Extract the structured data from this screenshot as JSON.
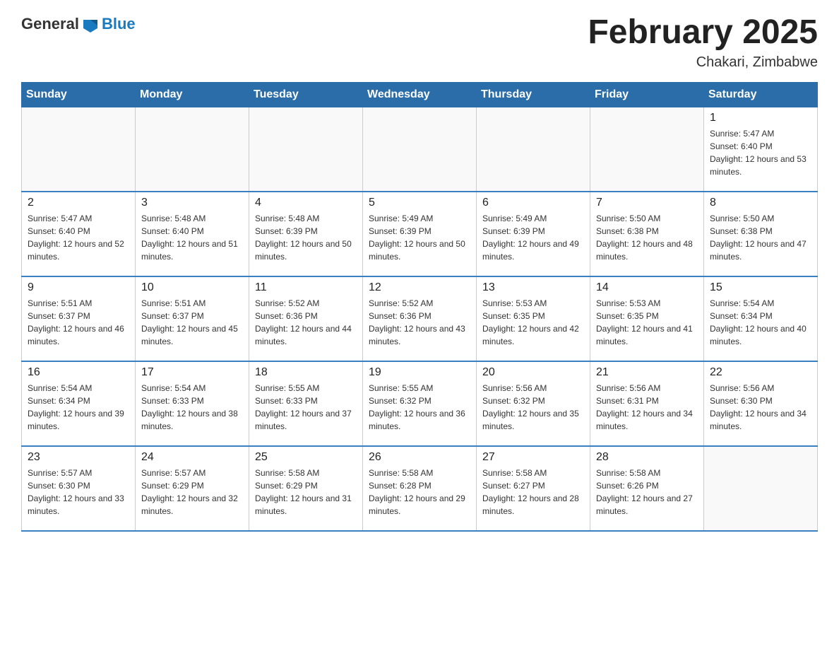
{
  "header": {
    "logo": {
      "general": "General",
      "blue": "Blue"
    },
    "title": "February 2025",
    "location": "Chakari, Zimbabwe"
  },
  "weekdays": [
    "Sunday",
    "Monday",
    "Tuesday",
    "Wednesday",
    "Thursday",
    "Friday",
    "Saturday"
  ],
  "weeks": [
    [
      {
        "day": "",
        "sunrise": "",
        "sunset": "",
        "daylight": ""
      },
      {
        "day": "",
        "sunrise": "",
        "sunset": "",
        "daylight": ""
      },
      {
        "day": "",
        "sunrise": "",
        "sunset": "",
        "daylight": ""
      },
      {
        "day": "",
        "sunrise": "",
        "sunset": "",
        "daylight": ""
      },
      {
        "day": "",
        "sunrise": "",
        "sunset": "",
        "daylight": ""
      },
      {
        "day": "",
        "sunrise": "",
        "sunset": "",
        "daylight": ""
      },
      {
        "day": "1",
        "sunrise": "Sunrise: 5:47 AM",
        "sunset": "Sunset: 6:40 PM",
        "daylight": "Daylight: 12 hours and 53 minutes."
      }
    ],
    [
      {
        "day": "2",
        "sunrise": "Sunrise: 5:47 AM",
        "sunset": "Sunset: 6:40 PM",
        "daylight": "Daylight: 12 hours and 52 minutes."
      },
      {
        "day": "3",
        "sunrise": "Sunrise: 5:48 AM",
        "sunset": "Sunset: 6:40 PM",
        "daylight": "Daylight: 12 hours and 51 minutes."
      },
      {
        "day": "4",
        "sunrise": "Sunrise: 5:48 AM",
        "sunset": "Sunset: 6:39 PM",
        "daylight": "Daylight: 12 hours and 50 minutes."
      },
      {
        "day": "5",
        "sunrise": "Sunrise: 5:49 AM",
        "sunset": "Sunset: 6:39 PM",
        "daylight": "Daylight: 12 hours and 50 minutes."
      },
      {
        "day": "6",
        "sunrise": "Sunrise: 5:49 AM",
        "sunset": "Sunset: 6:39 PM",
        "daylight": "Daylight: 12 hours and 49 minutes."
      },
      {
        "day": "7",
        "sunrise": "Sunrise: 5:50 AM",
        "sunset": "Sunset: 6:38 PM",
        "daylight": "Daylight: 12 hours and 48 minutes."
      },
      {
        "day": "8",
        "sunrise": "Sunrise: 5:50 AM",
        "sunset": "Sunset: 6:38 PM",
        "daylight": "Daylight: 12 hours and 47 minutes."
      }
    ],
    [
      {
        "day": "9",
        "sunrise": "Sunrise: 5:51 AM",
        "sunset": "Sunset: 6:37 PM",
        "daylight": "Daylight: 12 hours and 46 minutes."
      },
      {
        "day": "10",
        "sunrise": "Sunrise: 5:51 AM",
        "sunset": "Sunset: 6:37 PM",
        "daylight": "Daylight: 12 hours and 45 minutes."
      },
      {
        "day": "11",
        "sunrise": "Sunrise: 5:52 AM",
        "sunset": "Sunset: 6:36 PM",
        "daylight": "Daylight: 12 hours and 44 minutes."
      },
      {
        "day": "12",
        "sunrise": "Sunrise: 5:52 AM",
        "sunset": "Sunset: 6:36 PM",
        "daylight": "Daylight: 12 hours and 43 minutes."
      },
      {
        "day": "13",
        "sunrise": "Sunrise: 5:53 AM",
        "sunset": "Sunset: 6:35 PM",
        "daylight": "Daylight: 12 hours and 42 minutes."
      },
      {
        "day": "14",
        "sunrise": "Sunrise: 5:53 AM",
        "sunset": "Sunset: 6:35 PM",
        "daylight": "Daylight: 12 hours and 41 minutes."
      },
      {
        "day": "15",
        "sunrise": "Sunrise: 5:54 AM",
        "sunset": "Sunset: 6:34 PM",
        "daylight": "Daylight: 12 hours and 40 minutes."
      }
    ],
    [
      {
        "day": "16",
        "sunrise": "Sunrise: 5:54 AM",
        "sunset": "Sunset: 6:34 PM",
        "daylight": "Daylight: 12 hours and 39 minutes."
      },
      {
        "day": "17",
        "sunrise": "Sunrise: 5:54 AM",
        "sunset": "Sunset: 6:33 PM",
        "daylight": "Daylight: 12 hours and 38 minutes."
      },
      {
        "day": "18",
        "sunrise": "Sunrise: 5:55 AM",
        "sunset": "Sunset: 6:33 PM",
        "daylight": "Daylight: 12 hours and 37 minutes."
      },
      {
        "day": "19",
        "sunrise": "Sunrise: 5:55 AM",
        "sunset": "Sunset: 6:32 PM",
        "daylight": "Daylight: 12 hours and 36 minutes."
      },
      {
        "day": "20",
        "sunrise": "Sunrise: 5:56 AM",
        "sunset": "Sunset: 6:32 PM",
        "daylight": "Daylight: 12 hours and 35 minutes."
      },
      {
        "day": "21",
        "sunrise": "Sunrise: 5:56 AM",
        "sunset": "Sunset: 6:31 PM",
        "daylight": "Daylight: 12 hours and 34 minutes."
      },
      {
        "day": "22",
        "sunrise": "Sunrise: 5:56 AM",
        "sunset": "Sunset: 6:30 PM",
        "daylight": "Daylight: 12 hours and 34 minutes."
      }
    ],
    [
      {
        "day": "23",
        "sunrise": "Sunrise: 5:57 AM",
        "sunset": "Sunset: 6:30 PM",
        "daylight": "Daylight: 12 hours and 33 minutes."
      },
      {
        "day": "24",
        "sunrise": "Sunrise: 5:57 AM",
        "sunset": "Sunset: 6:29 PM",
        "daylight": "Daylight: 12 hours and 32 minutes."
      },
      {
        "day": "25",
        "sunrise": "Sunrise: 5:58 AM",
        "sunset": "Sunset: 6:29 PM",
        "daylight": "Daylight: 12 hours and 31 minutes."
      },
      {
        "day": "26",
        "sunrise": "Sunrise: 5:58 AM",
        "sunset": "Sunset: 6:28 PM",
        "daylight": "Daylight: 12 hours and 29 minutes."
      },
      {
        "day": "27",
        "sunrise": "Sunrise: 5:58 AM",
        "sunset": "Sunset: 6:27 PM",
        "daylight": "Daylight: 12 hours and 28 minutes."
      },
      {
        "day": "28",
        "sunrise": "Sunrise: 5:58 AM",
        "sunset": "Sunset: 6:26 PM",
        "daylight": "Daylight: 12 hours and 27 minutes."
      },
      {
        "day": "",
        "sunrise": "",
        "sunset": "",
        "daylight": ""
      }
    ]
  ]
}
